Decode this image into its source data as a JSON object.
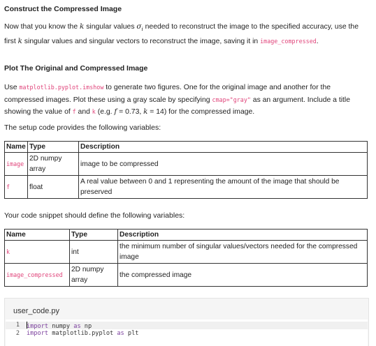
{
  "section1": {
    "heading": "Construct the Compressed Image",
    "p1_a": "Now that you know the ",
    "k": "k",
    "p1_b": " singular values ",
    "sigma": "σ",
    "sub_i": "i",
    "p1_c": " needed to reconstruct the image to the specified accuracy, use the first ",
    "p1_d": " singular values and singular vectors to reconstruct the image, saving it in ",
    "p1_code": "image_compressed",
    "p1_end": "."
  },
  "section2": {
    "heading": "Plot The Original and Compressed Image",
    "p_a": "Use ",
    "p_code1": "matplotlib.pyplot.imshow",
    "p_b": " to generate two figures. One for the original image and another for the compressed images. Plot these using a gray scale by specifying ",
    "p_code2": "cmap=\"gray\"",
    "p_c": " as an argument. Include a title showing the value of ",
    "p_code3": "f",
    "p_d": " and ",
    "p_code4": "k",
    "p_e": " (e.g. ",
    "f_var": "f",
    "f_eq": " = 0.73, ",
    "k_var": "k",
    "k_eq": " = 14) for the compressed image."
  },
  "setup": {
    "intro": "The setup code provides the following variables:",
    "headers": [
      "Name",
      "Type",
      "Description"
    ],
    "rows": [
      {
        "name": "image",
        "type": "2D numpy array",
        "desc": "image to be compressed"
      },
      {
        "name": "f",
        "type": "float",
        "desc": "A real value between 0 and 1 representing the amount of the image that should be preserved"
      }
    ]
  },
  "define": {
    "intro": "Your code snippet should define the following variables:",
    "headers": [
      "Name",
      "Type",
      "Description"
    ],
    "rows": [
      {
        "name": "k",
        "type": "int",
        "desc": "the minimum number of singular values/vectors needed for the compressed image"
      },
      {
        "name": "image_compressed",
        "type": "2D numpy array",
        "desc": "the compressed image"
      }
    ]
  },
  "editor": {
    "filename": "user_code.py",
    "lines": [
      {
        "num": "1",
        "kw1": "import",
        "mod": " numpy ",
        "kw2": "as",
        "alias": " np"
      },
      {
        "num": "2",
        "kw1": "import",
        "mod": " matplotlib.pyplot ",
        "kw2": "as",
        "alias": " plt"
      }
    ]
  },
  "colors": {
    "code_pink": "#e0457b",
    "keyword": "#7a3e9d",
    "editor_bg": "#f5f5f5"
  }
}
